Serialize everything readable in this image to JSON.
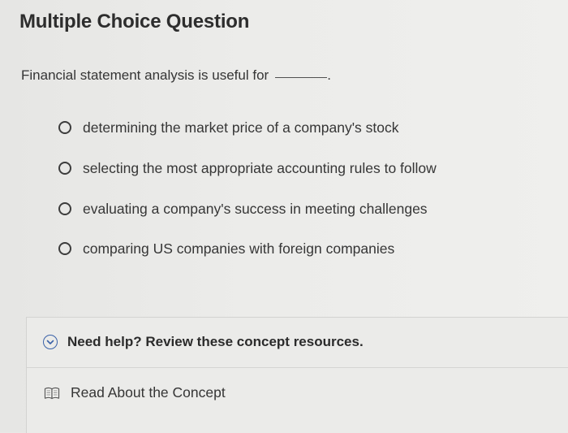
{
  "header": {
    "title": "Multiple Choice Question"
  },
  "question": {
    "prompt": "Financial statement analysis is useful for",
    "blank_suffix": "."
  },
  "options": [
    {
      "label": "determining the market price of a company's stock",
      "selected": false
    },
    {
      "label": "selecting the most appropriate accounting rules to follow",
      "selected": false
    },
    {
      "label": "evaluating a company's success in meeting challenges",
      "selected": false
    },
    {
      "label": "comparing US companies with foreign companies",
      "selected": false
    }
  ],
  "help": {
    "toggle_label": "Need help? Review these concept resources.",
    "toggle_icon": "chevron-down-circle-icon",
    "resources": [
      {
        "label": "Read About the Concept",
        "icon": "book-icon"
      }
    ]
  },
  "colors": {
    "accent": "#3a62a8",
    "background": "#ebebe9",
    "text": "#2f2f2f"
  }
}
